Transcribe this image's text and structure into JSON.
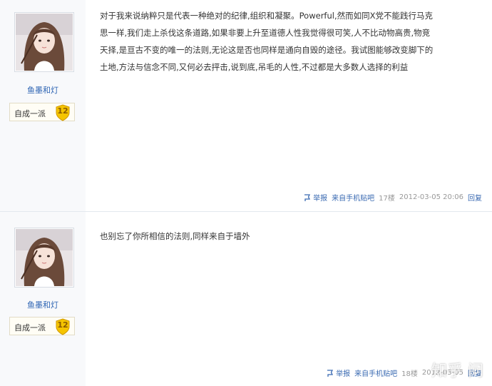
{
  "posts": [
    {
      "author": {
        "name": "鱼墨和灯",
        "level_title": "自成一派",
        "level": "12"
      },
      "content": [
        "对于我来说纳粹只是代表一种绝对的纪律,组织和凝聚。Powerful,然而如同X党不能践行马克",
        "思一样,我们走上杀伐这条道路,如果非要上升至道德人性我觉得很可笑,人不比动物高贵,物竞",
        "天择,是亘古不变的唯一的法则,无论这是否也同样是通向自毁的途径。我试图能够改变脚下的",
        "土地,方法与信念不同,又何必去抨击,说到底,吊毛的人性,不过都是大多数人选择的利益"
      ],
      "tail": {
        "report": "举报",
        "source": "来自手机贴吧",
        "floor": "17楼",
        "time": "2012-03-05 20:06",
        "reply": "回复"
      }
    },
    {
      "author": {
        "name": "鱼墨和灯",
        "level_title": "自成一派",
        "level": "12"
      },
      "content": [
        "也别忘了你所相信的法则,同样来自于墙外"
      ],
      "tail": {
        "report": "举报",
        "source": "来自手机贴吧",
        "floor": "18楼",
        "time": "2012-03-05",
        "reply": "回复"
      }
    }
  ],
  "watermark": "知乎 问",
  "colors": {
    "link": "#2d64b3",
    "text": "#333333",
    "meta": "#999999",
    "sidebar": "#f8f9fb",
    "badge": "#f5c400"
  },
  "icons": {
    "report": "report-icon",
    "level": "shield-badge-icon"
  }
}
